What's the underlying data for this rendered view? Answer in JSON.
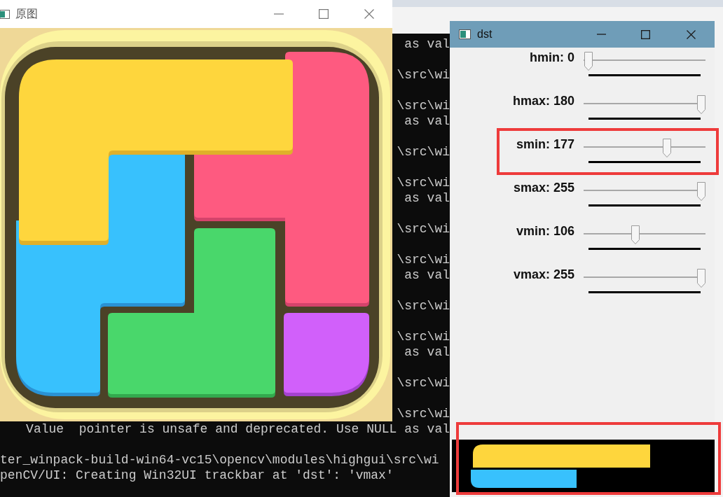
{
  "console": {
    "lines": [
      {
        "kind": "tail",
        "text": "as val"
      },
      {
        "kind": "blank"
      },
      {
        "kind": "tail",
        "text": "\\src\\wi"
      },
      {
        "kind": "blank"
      },
      {
        "kind": "tail",
        "text": "\\src\\wi"
      },
      {
        "kind": "tail",
        "text": "as val"
      },
      {
        "kind": "blank"
      },
      {
        "kind": "tail",
        "text": "\\src\\wi"
      },
      {
        "kind": "blank"
      },
      {
        "kind": "tail",
        "text": "\\src\\wi"
      },
      {
        "kind": "tail",
        "text": "as val"
      },
      {
        "kind": "blank"
      },
      {
        "kind": "tail",
        "text": "\\src\\wi"
      },
      {
        "kind": "blank"
      },
      {
        "kind": "tail",
        "text": "\\src\\wi"
      },
      {
        "kind": "tail",
        "text": "as val"
      },
      {
        "kind": "blank"
      },
      {
        "kind": "tail",
        "text": "\\src\\wi"
      },
      {
        "kind": "blank"
      },
      {
        "kind": "tail",
        "text": "\\src\\wi"
      },
      {
        "kind": "tail",
        "text": "as val"
      },
      {
        "kind": "blank"
      },
      {
        "kind": "tail",
        "text": "\\src\\wi"
      },
      {
        "kind": "blank"
      },
      {
        "kind": "tail",
        "text": "\\src\\wi"
      },
      {
        "kind": "tail",
        "text": "Value  pointer is unsafe and deprecated. Use NULL as val"
      },
      {
        "kind": "blank"
      },
      {
        "kind": "line",
        "text": "ter_winpack-build-win64-vc15\\opencv\\modules\\highgui\\src\\wi"
      },
      {
        "kind": "line",
        "text": "penCV/UI: Creating Win32UI trackbar at 'dst': 'vmax'"
      }
    ]
  },
  "image_window": {
    "title": "原图"
  },
  "trackbar_window": {
    "title": "dst",
    "trackbars": [
      {
        "label": "hmin: 0",
        "level": 0,
        "highlighted": false
      },
      {
        "label": "hmax: 180",
        "level": 1,
        "highlighted": false
      },
      {
        "label": "smin: 177",
        "level": 0.694,
        "highlighted": true
      },
      {
        "label": "smax: 255",
        "level": 1,
        "highlighted": false
      },
      {
        "label": "vmin: 106",
        "level": 0.416,
        "highlighted": false
      },
      {
        "label": "vmax: 255",
        "level": 1,
        "highlighted": false
      }
    ],
    "output_image": {
      "highlighted": true
    }
  }
}
